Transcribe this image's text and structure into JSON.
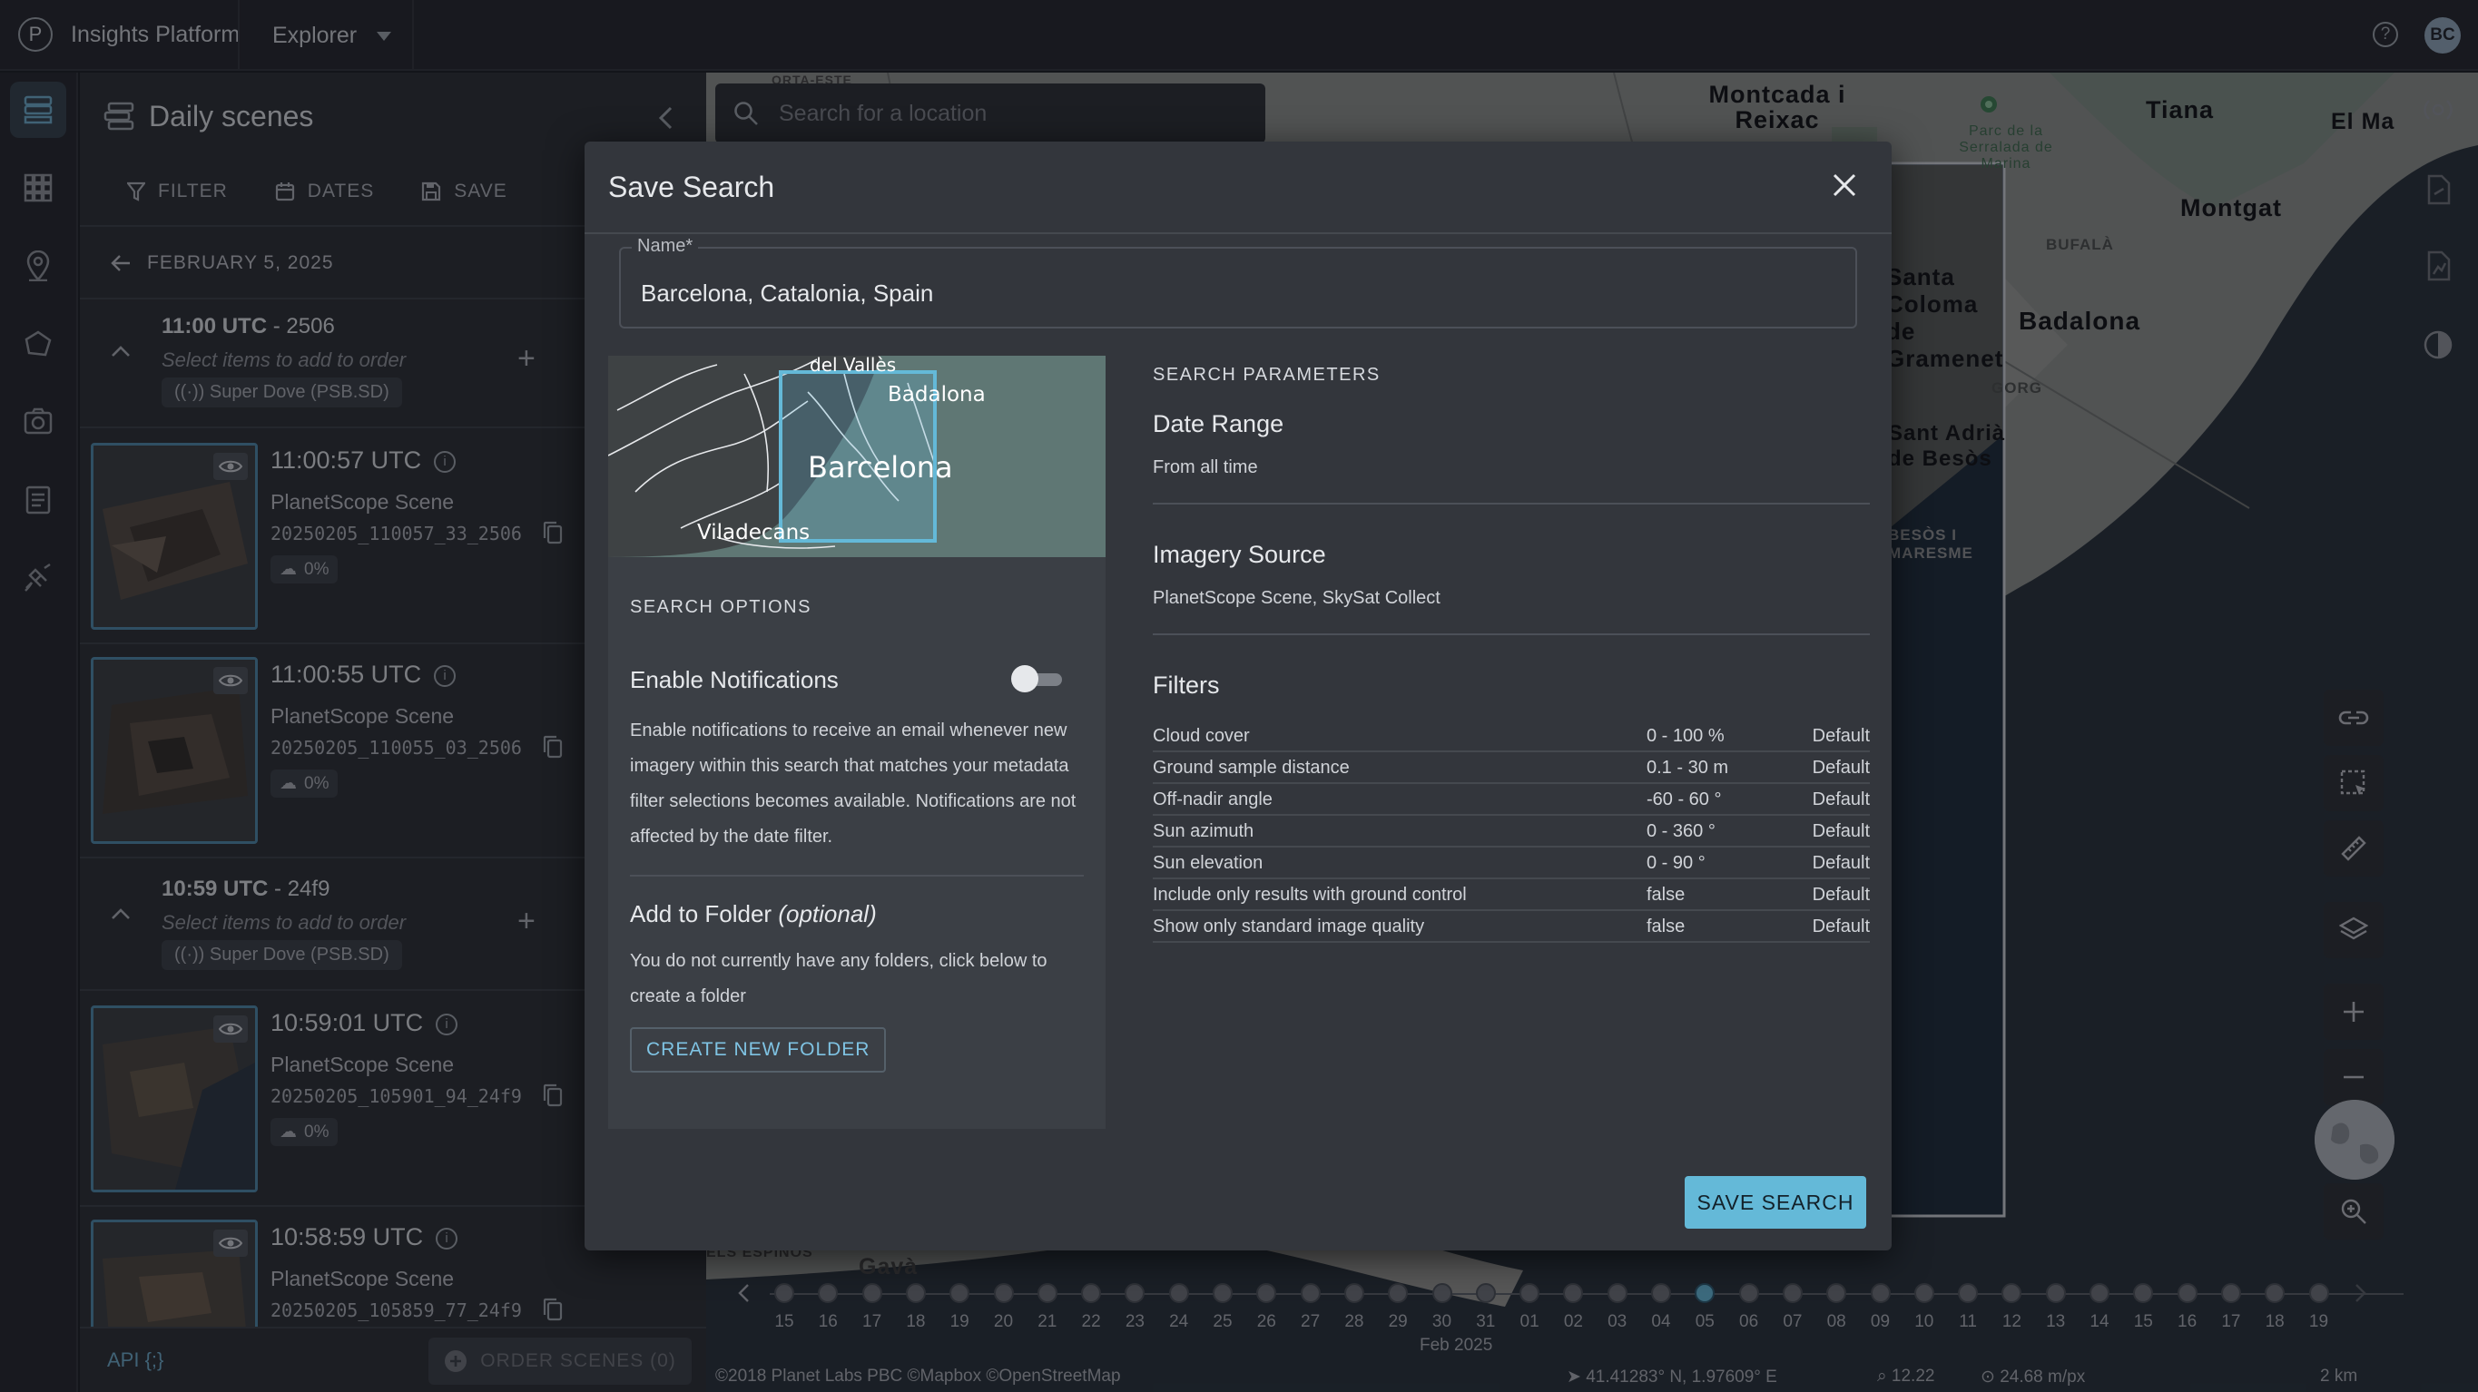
{
  "topbar": {
    "brand_letter": "P",
    "brand": "Insights Platform",
    "explorer": "Explorer",
    "avatar_initials": "BC"
  },
  "panel": {
    "title": "Daily scenes",
    "tabs": [
      {
        "label": "FILTER",
        "icon": "filter-icon"
      },
      {
        "label": "DATES",
        "icon": "calendar-icon"
      },
      {
        "label": "SAVE",
        "icon": "save-icon"
      }
    ],
    "date": "FEBRUARY 5, 2025",
    "groups": [
      {
        "time": "11:00 UTC",
        "code": "- 2506",
        "hint": "Select items to add to order",
        "satellite": "Super Dove (PSB.SD)"
      },
      {
        "time": "10:59 UTC",
        "code": "- 24f9",
        "hint": "Select items to add to order",
        "satellite": "Super Dove (PSB.SD)"
      }
    ],
    "scenes": [
      {
        "time": "11:00:57 UTC",
        "type": "PlanetScope Scene",
        "id": "20250205_110057_33_2506",
        "cloud": "0%"
      },
      {
        "time": "11:00:55 UTC",
        "type": "PlanetScope Scene",
        "id": "20250205_110055_03_2506",
        "cloud": "0%"
      },
      {
        "time": "10:59:01 UTC",
        "type": "PlanetScope Scene",
        "id": "20250205_105901_94_24f9",
        "cloud": "0%"
      },
      {
        "time": "10:58:59 UTC",
        "type": "PlanetScope Scene",
        "id": "20250205_105859_77_24f9",
        "cloud": "0%"
      }
    ],
    "api": "API {;}",
    "order_button": "ORDER SCENES (0)"
  },
  "map": {
    "search_placeholder": "Search for a location",
    "labels": {
      "montcada": "Montcada i Reixac",
      "tiana": "Tiana",
      "elmas": "El Ma",
      "montgat": "Montgat",
      "badalona": "Badalona",
      "parc": "Parc de la Serralada de Marina",
      "bufala": "BUFALÀ",
      "gorg": "GORG",
      "sant_adria": "Sant Adrià de Besòs",
      "besos": "BESÒS I MARESME",
      "santa": "Santa Coloma de Gramenet",
      "gava": "Gavà",
      "espinos": "ELS ESPINOS",
      "ortaeste": "ORTA-ESTE"
    },
    "timeline": {
      "days": [
        "15",
        "16",
        "17",
        "18",
        "19",
        "20",
        "21",
        "22",
        "23",
        "24",
        "25",
        "26",
        "27",
        "28",
        "29",
        "30",
        "31",
        "01",
        "02",
        "03",
        "04",
        "05",
        "06",
        "07",
        "08",
        "09",
        "10",
        "11",
        "12",
        "13",
        "14",
        "15",
        "16",
        "17",
        "18",
        "19"
      ],
      "month_label": "Feb 2025"
    },
    "status": {
      "copyright": "©2018 Planet Labs PBC ©Mapbox ©OpenStreetMap",
      "coords": "41.41283° N, 1.97609° E",
      "zoom": "12.22",
      "resolution": "24.68 m/px",
      "scale": "2 km"
    }
  },
  "modal": {
    "title": "Save Search",
    "name_label": "Name*",
    "name_value": "Barcelona, Catalonia, Spain",
    "preview_labels": {
      "city": "Barcelona",
      "north": "del Vallès",
      "east": "Badalona",
      "west": "Viladecans"
    },
    "search_options": {
      "heading": "SEARCH OPTIONS",
      "notifications_title": "Enable Notifications",
      "notifications_enabled": false,
      "notifications_desc": "Enable notifications to receive an email whenever new imagery within this search that matches your metadata filter selections becomes available. Notifications are not affected by the date filter.",
      "folder_title": "Add to Folder",
      "folder_optional": "(optional)",
      "folder_desc": "You do not currently have any folders, click below to create a folder",
      "create_folder": "CREATE NEW FOLDER"
    },
    "params": {
      "heading": "SEARCH PARAMETERS",
      "date_range_title": "Date Range",
      "date_range_value": "From all time",
      "imagery_title": "Imagery Source",
      "imagery_value": "PlanetScope Scene, SkySat Collect",
      "filters_title": "Filters",
      "filters": [
        {
          "name": "Cloud cover",
          "range": "0 - 100 %",
          "status": "Default"
        },
        {
          "name": "Ground sample distance",
          "range": "0.1 - 30 m",
          "status": "Default"
        },
        {
          "name": "Off-nadir angle",
          "range": "-60 - 60 °",
          "status": "Default"
        },
        {
          "name": "Sun azimuth",
          "range": "0 - 360 °",
          "status": "Default"
        },
        {
          "name": "Sun elevation",
          "range": "0 - 90 °",
          "status": "Default"
        },
        {
          "name": "Include only results with ground control",
          "range": "false",
          "status": "Default"
        },
        {
          "name": "Show only standard image quality",
          "range": "false",
          "status": "Default"
        }
      ]
    },
    "save_button": "SAVE SEARCH"
  },
  "colors": {
    "accent": "#64b9d8",
    "link": "#7fc3e3",
    "modal_bg": "#33363c",
    "panel_bg": "#2b2e34"
  }
}
